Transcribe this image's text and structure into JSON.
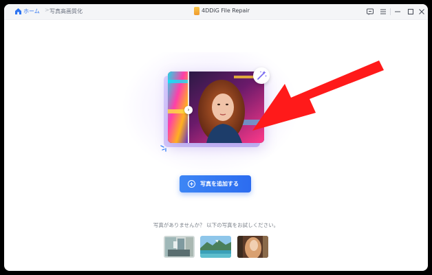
{
  "breadcrumb": {
    "home_label": "ホーム",
    "separator": ">",
    "current_label": "写真高画質化"
  },
  "app": {
    "title": "4DDiG File Repair"
  },
  "titlebar_icons": [
    "feedback-icon",
    "menu-icon",
    "minimize-icon",
    "maximize-icon",
    "close-icon"
  ],
  "main": {
    "add_button_label": "写真を追加する",
    "hint_text": "写真がありませんか？ 以下の写真をお試しください。",
    "samples": [
      "sample-photo-interior",
      "sample-photo-landscape",
      "sample-photo-portrait"
    ]
  },
  "colors": {
    "accent": "#2f74f0",
    "annotation_arrow": "#ff1a1a"
  }
}
